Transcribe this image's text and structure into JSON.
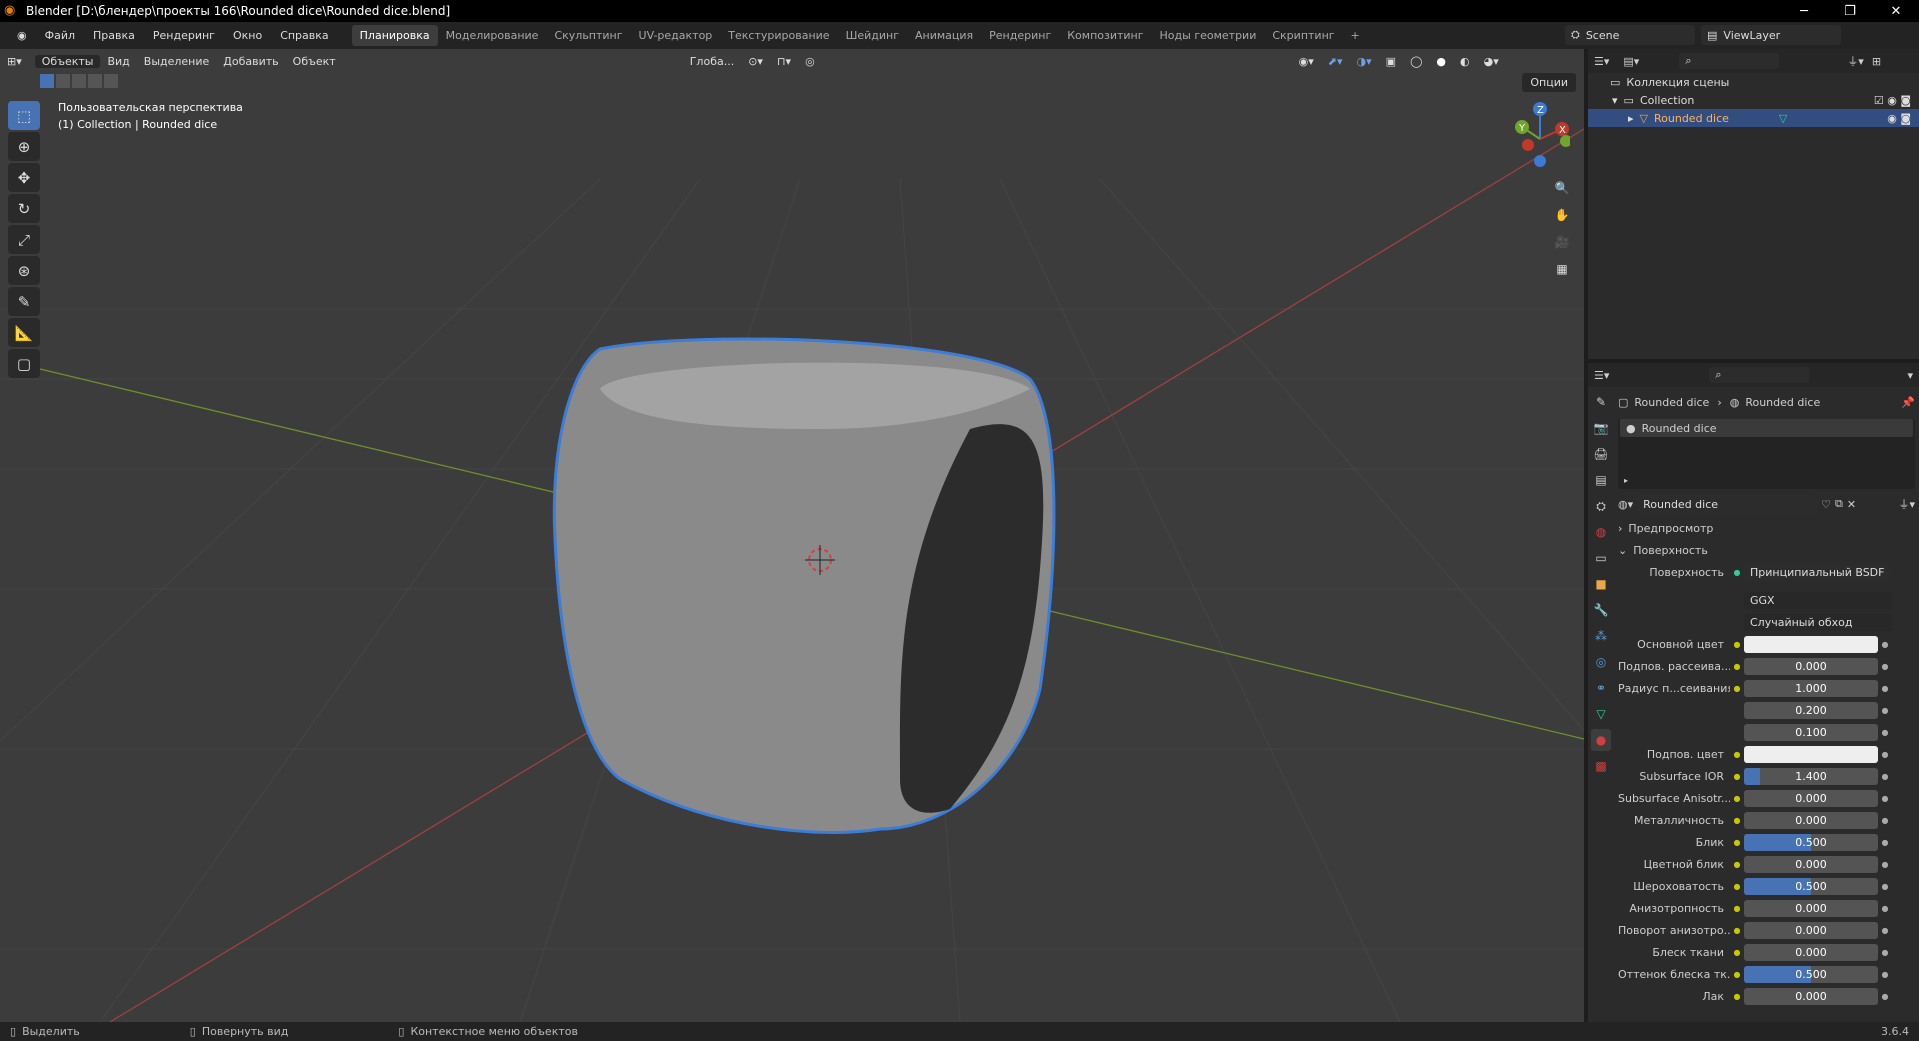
{
  "window": {
    "title": "Blender [D:\\блендер\\проекты 166\\Rounded dice\\Rounded dice.blend]"
  },
  "menu": [
    "Файл",
    "Правка",
    "Рендеринг",
    "Окно",
    "Справка"
  ],
  "workspaces": [
    "Планировка",
    "Моделирование",
    "Скульптинг",
    "UV-редактор",
    "Текстурирование",
    "Шейдинг",
    "Анимация",
    "Рендеринг",
    "Композитинг",
    "Ноды геометрии",
    "Скриптинг"
  ],
  "active_workspace": 0,
  "scene": {
    "name": "Scene",
    "view_layer": "ViewLayer"
  },
  "viewport": {
    "mode": "Объекты",
    "menus": [
      "Вид",
      "Выделение",
      "Добавить",
      "Объект"
    ],
    "transform_orientation": "Глоба...",
    "options": "Опции",
    "overlay_line1": "Пользовательская перспектива",
    "overlay_line2": "(1) Collection | Rounded dice",
    "gizmo": {
      "z": "Z",
      "y": "Y",
      "x": "X"
    }
  },
  "outliner": {
    "root": "Коллекция сцены",
    "collection": "Collection",
    "object": "Rounded dice"
  },
  "properties": {
    "breadcrumb_object": "Rounded dice",
    "breadcrumb_material": "Rounded dice",
    "material_slot": "Rounded dice",
    "material_name": "Rounded dice",
    "panel_preview": "Предпросмотр",
    "panel_surface": "Поверхность",
    "surface_label": "Поверхность",
    "surface_value": "Принципиальный BSDF",
    "distribution": "GGX",
    "subsurface_method": "Случайный обход",
    "rows": [
      {
        "label": "Основной цвет",
        "type": "color",
        "value": ""
      },
      {
        "label": "Подпов. рассеива...",
        "type": "num",
        "value": "0.000",
        "fill": 0
      },
      {
        "label": "Радиус п...сеивания",
        "type": "num",
        "value": "1.000",
        "fill": 0
      },
      {
        "label": "",
        "type": "num",
        "value": "0.200",
        "fill": 0
      },
      {
        "label": "",
        "type": "num",
        "value": "0.100",
        "fill": 0
      },
      {
        "label": "Подпов. цвет",
        "type": "color",
        "value": ""
      },
      {
        "label": "Subsurface IOR",
        "type": "num",
        "value": "1.400",
        "fill": 0.12
      },
      {
        "label": "Subsurface Anisotr...",
        "type": "num",
        "value": "0.000",
        "fill": 0
      },
      {
        "label": "Металличность",
        "type": "num",
        "value": "0.000",
        "fill": 0
      },
      {
        "label": "Блик",
        "type": "num",
        "value": "0.500",
        "fill": 0.5
      },
      {
        "label": "Цветной блик",
        "type": "num",
        "value": "0.000",
        "fill": 0
      },
      {
        "label": "Шероховатость",
        "type": "num",
        "value": "0.500",
        "fill": 0.5
      },
      {
        "label": "Анизотропность",
        "type": "num",
        "value": "0.000",
        "fill": 0
      },
      {
        "label": "Поворот анизотро...",
        "type": "num",
        "value": "0.000",
        "fill": 0
      },
      {
        "label": "Блеск ткани",
        "type": "num",
        "value": "0.000",
        "fill": 0
      },
      {
        "label": "Оттенок блеска тк...",
        "type": "num",
        "value": "0.500",
        "fill": 0.5
      },
      {
        "label": "Лак",
        "type": "num",
        "value": "0.000",
        "fill": 0
      }
    ]
  },
  "status": {
    "select": "Выделить",
    "rotate": "Повернуть вид",
    "context": "Контекстное меню объектов",
    "version": "3.6.4"
  },
  "colors": {
    "accent": "#4772b3",
    "outline": "#3b7dd8",
    "x_axis": "#c0392b",
    "y_axis": "#8ab02b"
  }
}
